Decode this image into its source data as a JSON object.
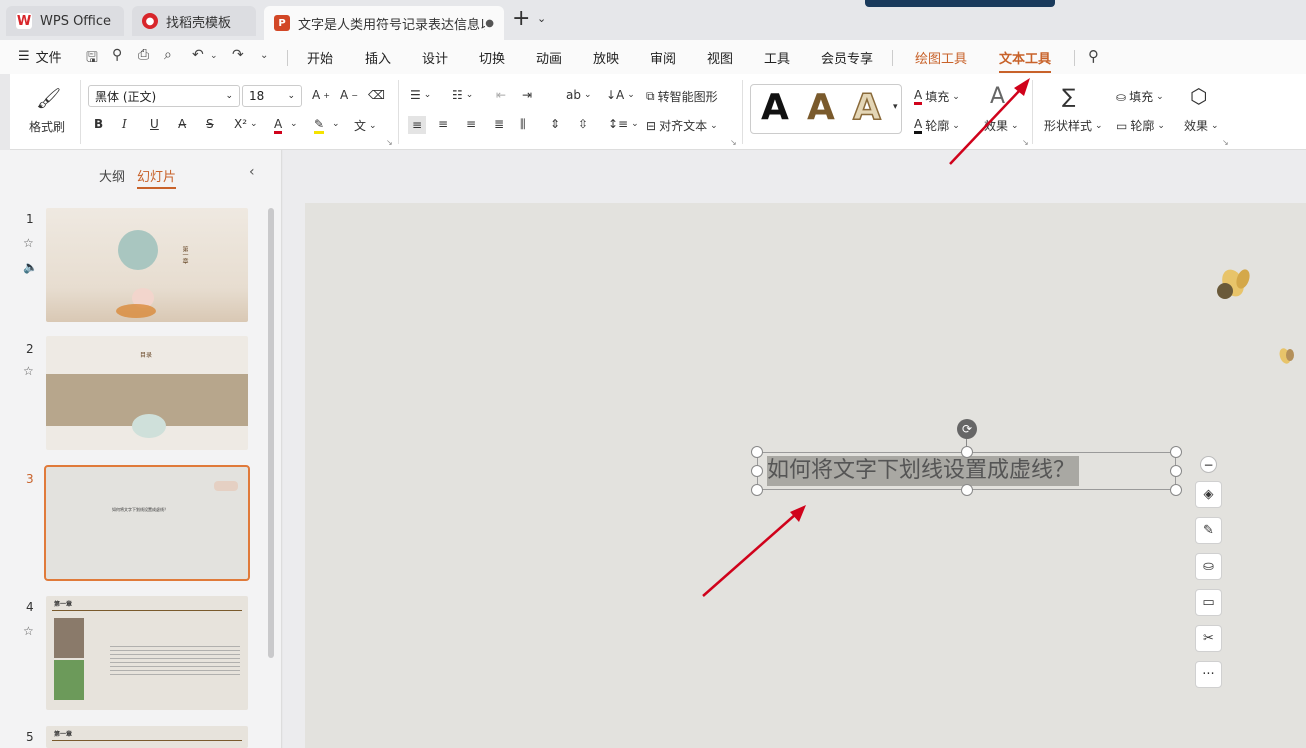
{
  "tabs": [
    {
      "label": "WPS Office",
      "icon": "wps-logo-icon"
    },
    {
      "label": "找稻壳模板",
      "icon": "docer-icon"
    },
    {
      "label": "文字是人类用符号记录表达信息以",
      "icon": "ppt-doc-icon",
      "badge": "P"
    }
  ],
  "menu": {
    "file": "文件",
    "items": [
      "开始",
      "插入",
      "设计",
      "切换",
      "动画",
      "放映",
      "审阅",
      "视图",
      "工具",
      "会员专享"
    ],
    "context_items": [
      "绘图工具",
      "文本工具"
    ],
    "active": "文本工具"
  },
  "ribbon": {
    "format_painter": "格式刷",
    "font_name": "黑体 (正文)",
    "font_size": "18",
    "smart_shape": "转智能图形",
    "align_text": "对齐文本",
    "text_fill": "填充",
    "text_outline": "轮廓",
    "text_effect": "效果",
    "shape_style": "形状样式",
    "shape_fill": "填充",
    "shape_outline": "轮廓",
    "shape_effect": "效果",
    "style_letters": [
      "A",
      "A",
      "A"
    ]
  },
  "left_panel": {
    "tab_outline": "大纲",
    "tab_slides": "幻灯片",
    "slides": [
      {
        "number": "1",
        "title": "第一章"
      },
      {
        "number": "2",
        "title": "目录"
      },
      {
        "number": "3",
        "title": "如何将文字下划线设置成虚线？"
      },
      {
        "number": "4",
        "title": "第一章"
      },
      {
        "number": "5",
        "title": "第一章"
      }
    ]
  },
  "slide": {
    "selected_text": "如何将文字下划线设置成虚线？"
  },
  "colors": {
    "accent": "#c8622a",
    "arrow": "#d0021b",
    "slide_bg": "#e3e2de"
  }
}
